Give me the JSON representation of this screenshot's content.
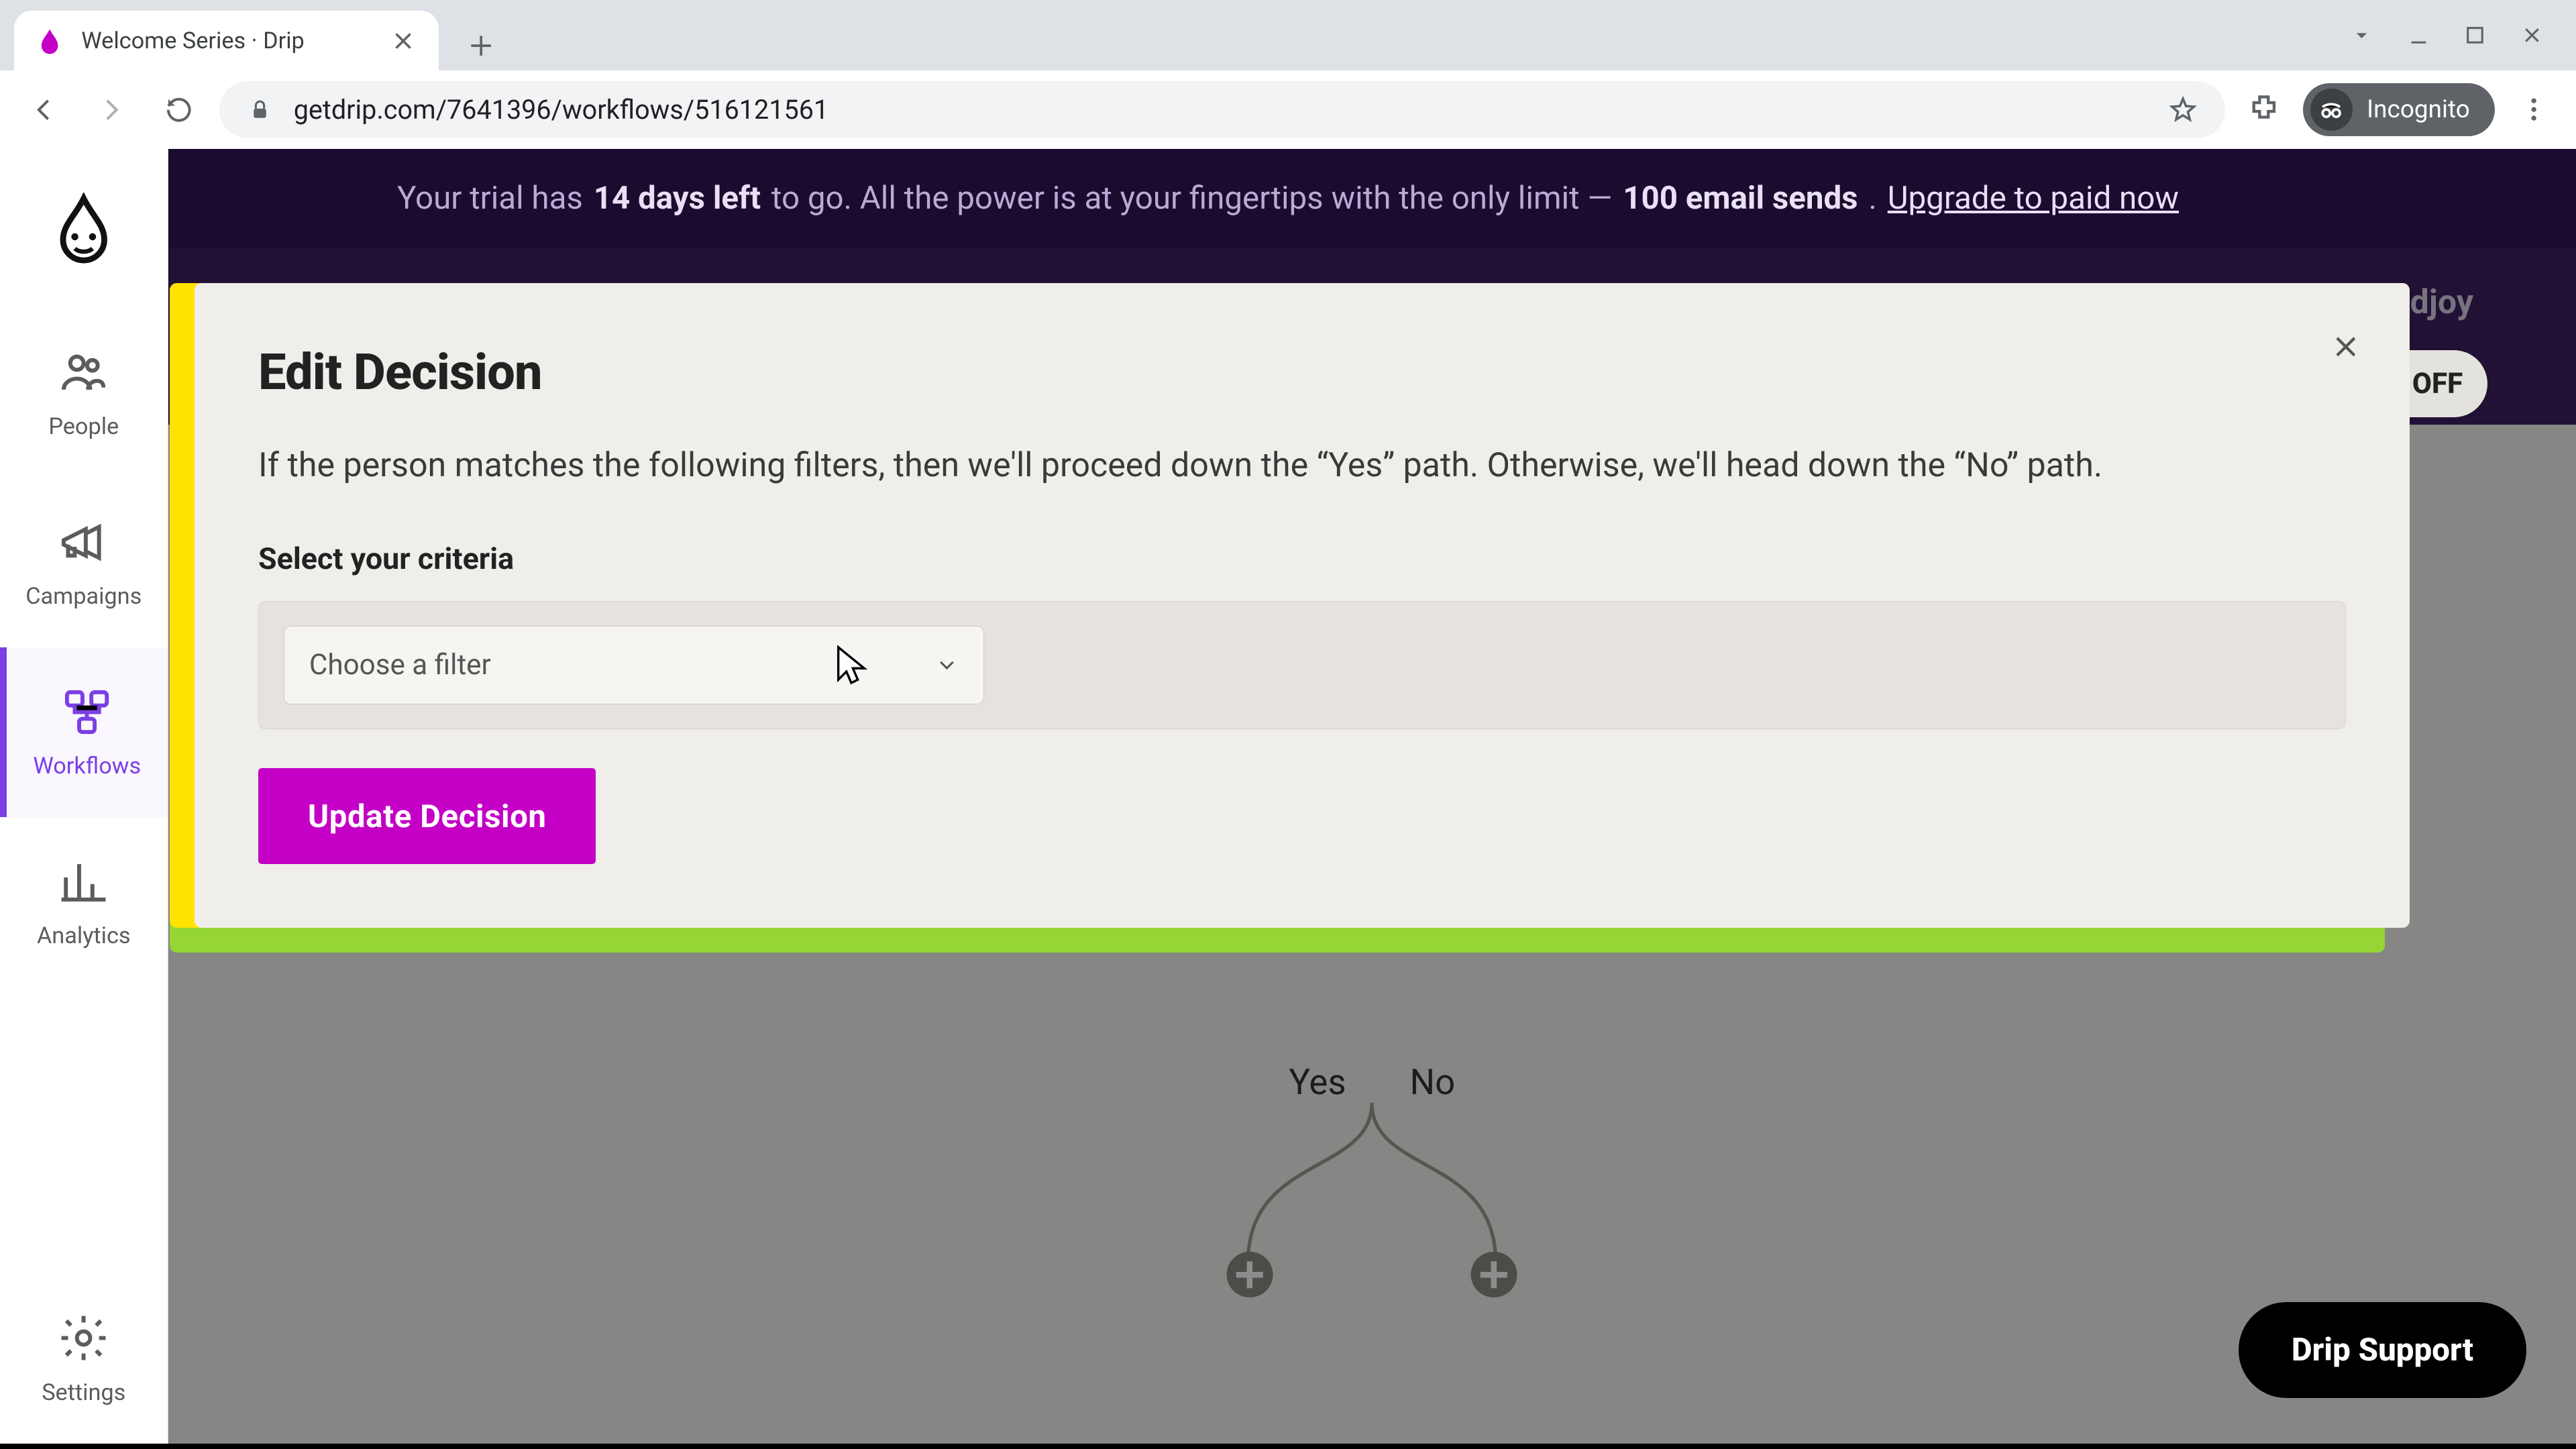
{
  "browser": {
    "tab_title": "Welcome Series · Drip",
    "url": "getdrip.com/7641396/workflows/516121561",
    "incognito_label": "Incognito"
  },
  "banner": {
    "prefix": "Your trial has ",
    "days": "14 days left",
    "middle": " to go. All the power is at your fingertips with the only limit — ",
    "limit": "100 email sends",
    "suffix": ". ",
    "cta": "Upgrade to paid now"
  },
  "sidebar": {
    "items": [
      {
        "label": "People"
      },
      {
        "label": "Campaigns"
      },
      {
        "label": "Workflows"
      },
      {
        "label": "Analytics"
      }
    ],
    "settings": "Settings"
  },
  "topbar": {
    "workspace": "Moodjoy",
    "toggle": "OFF"
  },
  "canvas": {
    "yes": "Yes",
    "no": "No"
  },
  "modal": {
    "title": "Edit Decision",
    "description": "If the person matches the following filters, then we'll proceed down the “Yes” path. Otherwise, we'll head down the “No” path.",
    "criteria_label": "Select your criteria",
    "filter_placeholder": "Choose a filter",
    "update": "Update Decision"
  },
  "support": {
    "label": "Drip Support"
  }
}
